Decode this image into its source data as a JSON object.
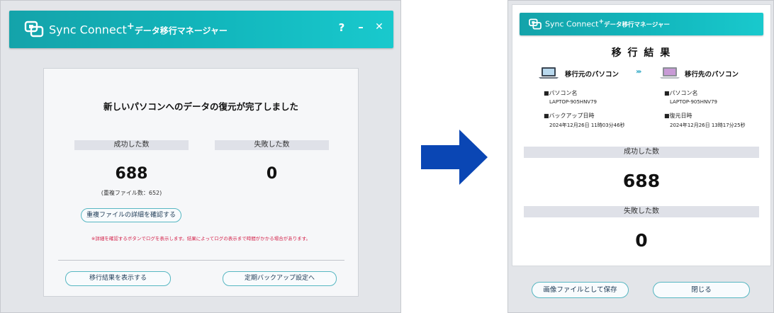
{
  "app": {
    "brand": "Sync Connect",
    "brand_sup": "+",
    "subtitle": "データ移行マネージャー"
  },
  "left": {
    "controls": {
      "help": "?",
      "minimize": "–",
      "close": "✕"
    },
    "heading": "新しいパソコンへのデータの復元が完了しました",
    "success_label": "成功した数",
    "success_value": "688",
    "duplicate_note": "(重複ファイル数：652)",
    "fail_label": "失敗した数",
    "fail_value": "0",
    "detail_button": "重複ファイルの詳細を確認する",
    "warning": "※詳細を確認するボタンでログを表示します。結果によってログの表示まで時間がかかる場合があります。",
    "show_result_button": "移行結果を表示する",
    "backup_button": "定期バックアップ設定へ"
  },
  "right": {
    "title": "移 行 結 果",
    "source": {
      "heading": "移行元のパソコン",
      "pc_name_label": "■パソコン名",
      "pc_name": "LAPTOP-905HNV79",
      "date_label": "■バックアップ日時",
      "date": "2024年12月26日 11時03分46秒"
    },
    "target": {
      "heading": "移行先のパソコン",
      "pc_name_label": "■パソコン名",
      "pc_name": "LAPTOP-905HNV79",
      "date_label": "■復元日時",
      "date": "2024年12月26日 13時17分25秒"
    },
    "success_label": "成功した数",
    "success_value": "688",
    "fail_label": "失敗した数",
    "fail_value": "0",
    "save_image_button": "画像ファイルとして保存",
    "close_button": "閉じる"
  },
  "colors": {
    "titlebar_teal": "#14a3aa",
    "arrow_blue": "#0a46b4",
    "warning_red": "#d4224a",
    "pill_border": "#57b7c2"
  }
}
